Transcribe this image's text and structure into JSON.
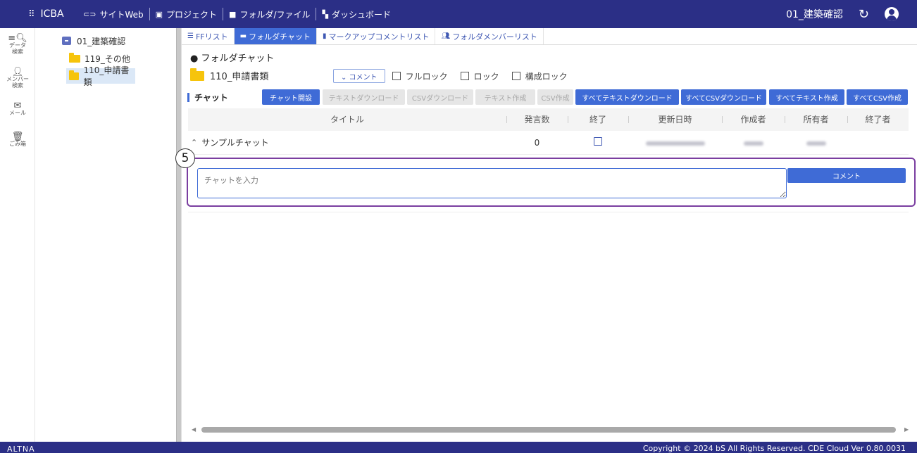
{
  "header": {
    "brand": "ICBA",
    "nav": [
      {
        "icon": "link-icon",
        "label": "サイトWeb"
      },
      {
        "icon": "archive-icon",
        "label": "プロジェクト"
      },
      {
        "icon": "folder-icon",
        "label": "フォルダ/ファイル"
      },
      {
        "icon": "dashboard-icon",
        "label": "ダッシュボード"
      }
    ],
    "project": "01_建築確認"
  },
  "rail": [
    {
      "icon": "data-search-icon",
      "line1": "データ",
      "line2": "検索"
    },
    {
      "icon": "member-search-icon",
      "line1": "メンバー",
      "line2": "検索"
    },
    {
      "icon": "mail-icon",
      "line1": "メール",
      "line2": ""
    },
    {
      "icon": "trash-icon",
      "line1": "ごみ箱",
      "line2": ""
    }
  ],
  "tree": {
    "root": "01_建築確認",
    "children": [
      "119_その他",
      "110_申請書類"
    ],
    "selected": "110_申請書類"
  },
  "tabs": [
    {
      "icon": "list-icon",
      "label": "FFリスト",
      "active": false
    },
    {
      "icon": "chat-icon",
      "label": "フォルダチャット",
      "active": true
    },
    {
      "icon": "markup-icon",
      "label": "マークアップコメントリスト",
      "active": false
    },
    {
      "icon": "members-icon",
      "label": "フォルダメンバーリスト",
      "active": false
    }
  ],
  "main": {
    "section_title": "● フォルダチャット",
    "folder_name": "110_申請書類",
    "comment_toggle": "⌄ コメント",
    "checkboxes": [
      "フルロック",
      "ロック",
      "構成ロック"
    ],
    "chat_label": "チャット"
  },
  "toolbar": {
    "buttons": [
      {
        "label": "チャット開設",
        "state": "primary"
      },
      {
        "label": "テキストダウンロード",
        "state": "disabled"
      },
      {
        "label": "CSVダウンロード",
        "state": "disabled"
      },
      {
        "label": "テキスト作成",
        "state": "disabled"
      },
      {
        "label": "CSV作成",
        "state": "disabled"
      },
      {
        "label": "すべてテキストダウンロード",
        "state": "primary"
      },
      {
        "label": "すべてCSVダウンロード",
        "state": "primary"
      },
      {
        "label": "すべてテキスト作成",
        "state": "primary"
      },
      {
        "label": "すべてCSV作成",
        "state": "primary"
      }
    ]
  },
  "table": {
    "columns": [
      "タイトル",
      "発言数",
      "終了",
      "更新日時",
      "作成者",
      "所有者",
      "終了者"
    ],
    "rows": [
      {
        "title": "サンプルチャット",
        "count": "0",
        "closed": false
      }
    ]
  },
  "chat_input": {
    "placeholder": "チャットを入力",
    "submit_label": "コメント"
  },
  "step_badge": "5",
  "footer": {
    "left": "ALTNA",
    "right": "Copyright © 2024 bS All Rights Reserved.  CDE Cloud Ver 0.80.0031"
  }
}
